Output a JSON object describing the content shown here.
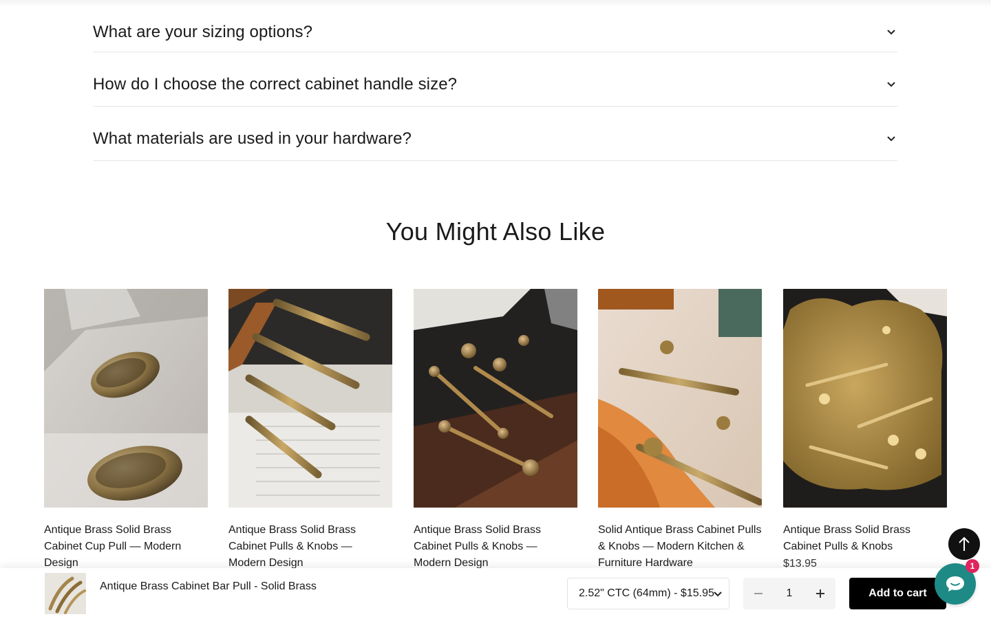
{
  "faq": {
    "items": [
      {
        "question": "What are your sizing options?"
      },
      {
        "question": "How do I choose the correct cabinet handle size?"
      },
      {
        "question": "What materials are used in your hardware?"
      }
    ]
  },
  "related": {
    "heading": "You Might Also Like",
    "products": [
      {
        "title": "Antique Brass Solid Brass Cabinet Cup Pull — Modern Design",
        "price": "",
        "image": "brass-cup-pulls-photo"
      },
      {
        "title": "Antique Brass Solid Brass Cabinet Pulls & Knobs — Modern Design",
        "price": "",
        "image": "brass-bar-pulls-photo"
      },
      {
        "title": "Antique Brass Solid Brass Cabinet Pulls & Knobs — Modern Design",
        "price": "",
        "image": "brass-knobs-dark-photo"
      },
      {
        "title": "Solid Antique Brass Cabinet Pulls & Knobs — Modern Kitchen & Furniture Hardware",
        "price": "",
        "image": "brass-pulls-orange-photo"
      },
      {
        "title": "Antique Brass Solid Brass Cabinet Pulls & Knobs",
        "price": "$13.95",
        "image": "brass-pulls-tray-photo"
      }
    ]
  },
  "sticky_bar": {
    "product_name": "Antique Brass Cabinet Bar Pull - Solid Brass",
    "variant": "2.52\" CTC (64mm) - $15.95",
    "quantity": "1",
    "add_to_cart": "Add to cart"
  },
  "chat": {
    "badge": "1"
  },
  "colors": {
    "accent": "#000000",
    "chat": "#1d8a86",
    "badge": "#e0245e"
  }
}
